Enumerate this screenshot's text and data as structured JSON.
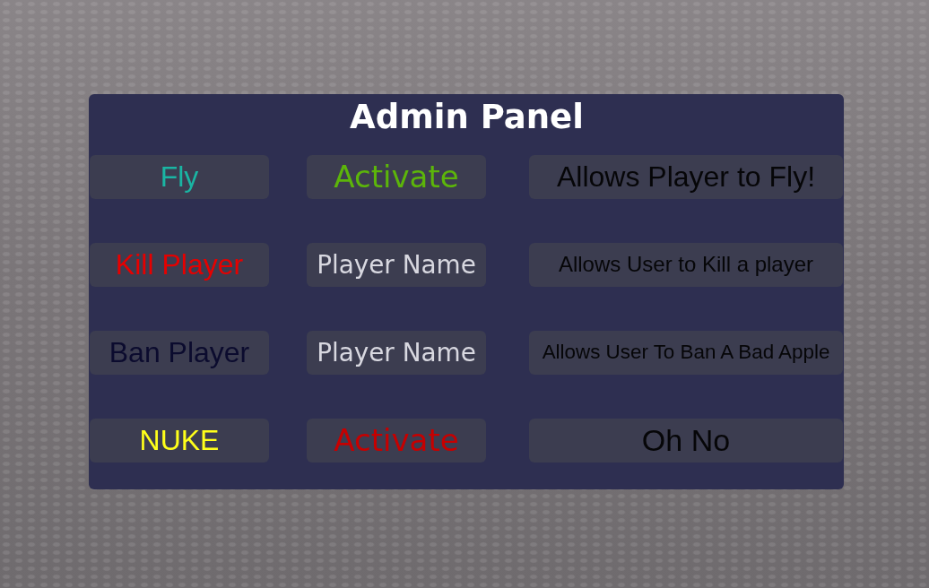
{
  "window": {
    "title": "Admin Panel"
  },
  "commands": [
    {
      "name": "Fly",
      "color": "#1ab5a3",
      "action": {
        "kind": "button",
        "label": "Activate",
        "color": "#5cb50a"
      },
      "description": "Allows Player to Fly!"
    },
    {
      "name": "Kill Player",
      "color": "#e60000",
      "action": {
        "kind": "field",
        "placeholder": "Player Name"
      },
      "description": "Allows User to Kill a player"
    },
    {
      "name": "Ban Player",
      "color": "#0b0b2e",
      "action": {
        "kind": "field",
        "placeholder": "Player Name"
      },
      "description": "Allows User To Ban A Bad Apple"
    },
    {
      "name": "NUKE",
      "color": "#ffff1a",
      "action": {
        "kind": "button",
        "label": "Activate",
        "color": "#c60000"
      },
      "description": "Oh No"
    }
  ]
}
